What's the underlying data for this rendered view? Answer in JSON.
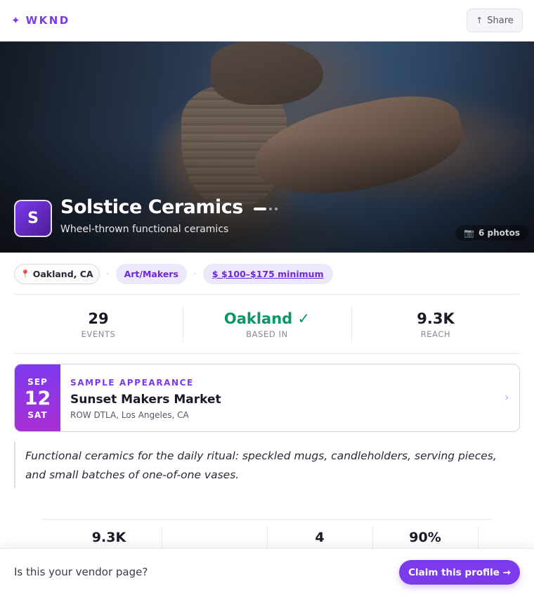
{
  "header": {
    "brand_mark": "✦",
    "brand_name": "WKND",
    "share_icon": "↑",
    "share_label": "Share"
  },
  "hero": {
    "avatar_initial": "S",
    "title": "Solstice Ceramics",
    "subtitle": "Wheel-thrown functional ceramics",
    "carousel_index": 1,
    "carousel_total": 3,
    "photos_icon": "📷",
    "photos_label": "6 photos"
  },
  "tags": {
    "location_icon": "📍",
    "location": "Oakland, CA",
    "separator": "·",
    "category": "Art/Makers",
    "price": "$ $100–$175 minimum"
  },
  "stats": [
    {
      "value": "29",
      "label": "EVENTS"
    },
    {
      "value": "Oakland ✓",
      "label": "BASED IN"
    },
    {
      "value": "9.3K",
      "label": "REACH"
    }
  ],
  "event": {
    "month": "SEP",
    "day": "12",
    "weekday": "SAT",
    "kicker": "SAMPLE APPEARANCE",
    "name": "Sunset Makers Market",
    "venue": "ROW DTLA, Los Angeles, CA",
    "chevron": "›"
  },
  "description": "Functional ceramics for the daily ritual: speckled mugs, candleholders, serving pieces, and small batches of one-of-one vases.",
  "lower_stats": [
    "9.3K",
    "",
    "4",
    "90%"
  ],
  "bottom_bar": {
    "question": "Is this your vendor page?",
    "claim_label": "Claim this profile →"
  },
  "colors": {
    "accent": "#7c3aed",
    "success": "#059669"
  }
}
